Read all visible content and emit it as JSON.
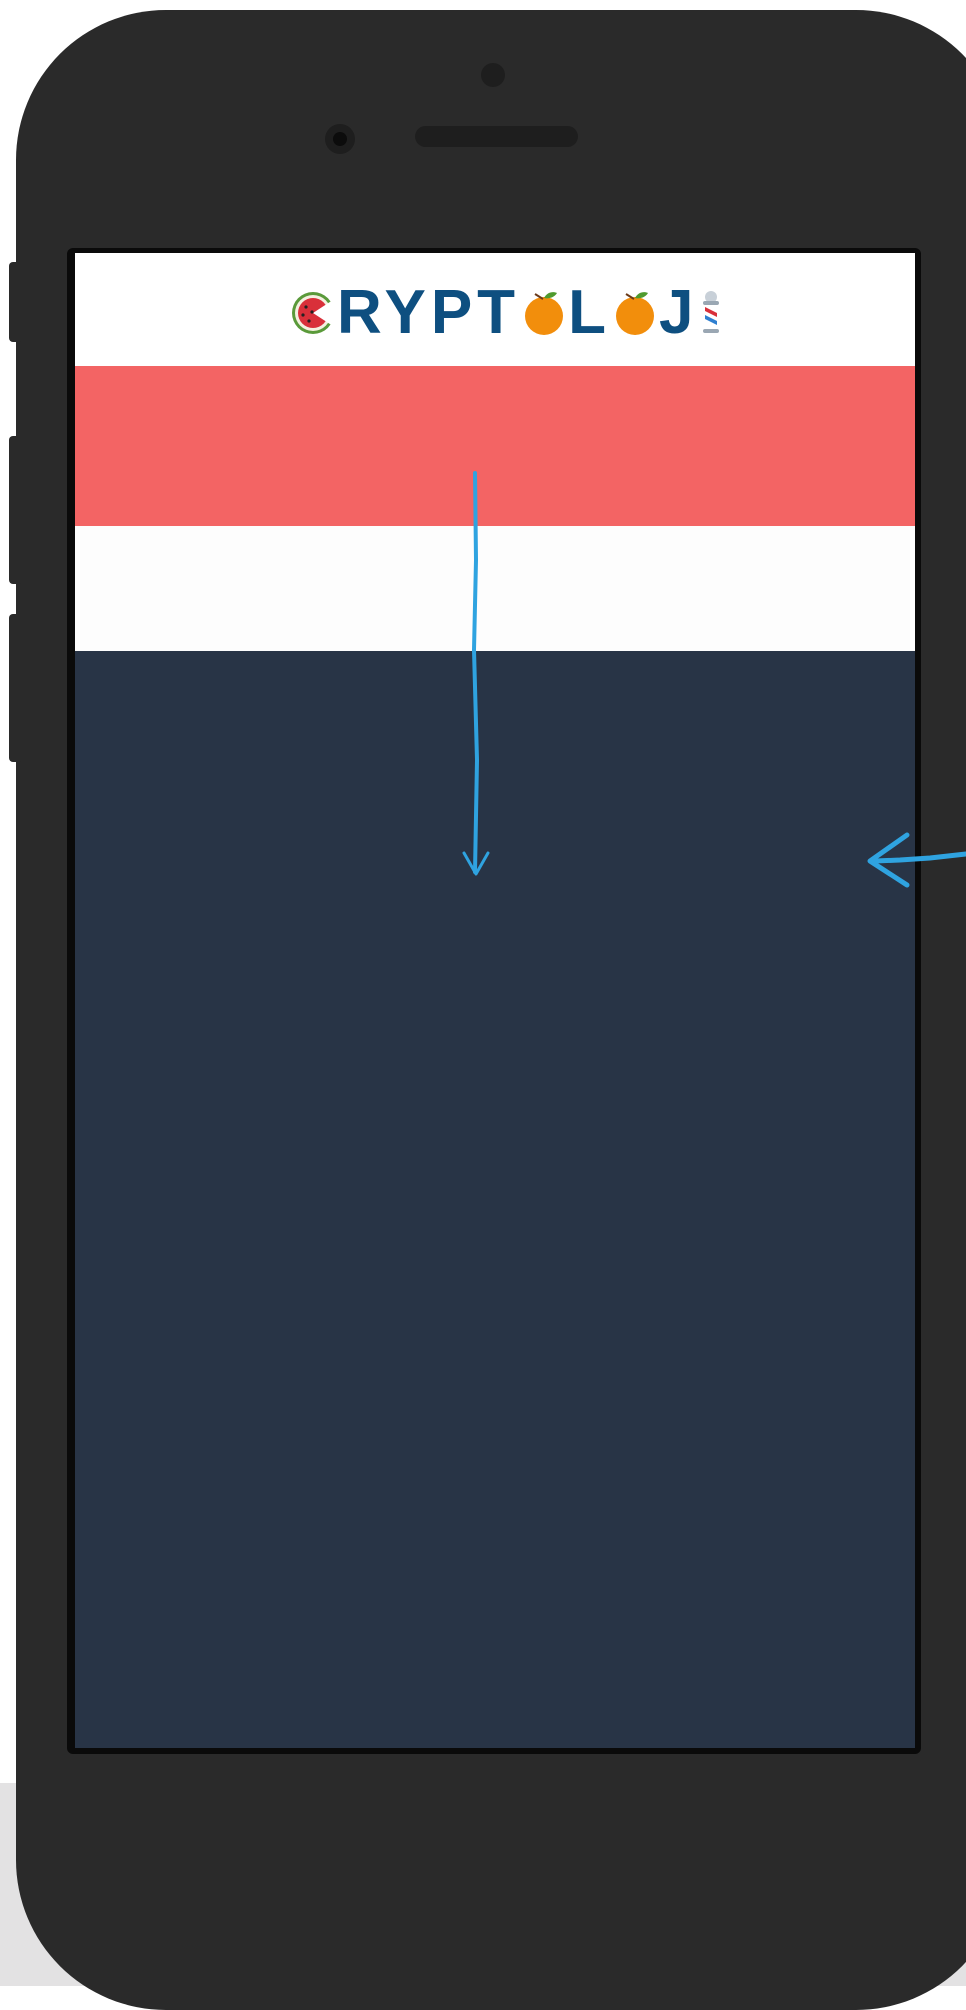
{
  "logo": {
    "text_segments": [
      "RYPT",
      "L",
      "J"
    ],
    "icons": [
      "watermelon-icon",
      "orange-icon",
      "orange-icon",
      "barber-pole-icon"
    ]
  },
  "colors": {
    "brand_text": "#0e4f80",
    "red_band": "#f36464",
    "dark_bg": "#283446",
    "phone_body": "#2a2a2a",
    "annotation_arrow": "#2fa3e0"
  },
  "annotations": [
    "arrow-down",
    "arrow-left"
  ]
}
